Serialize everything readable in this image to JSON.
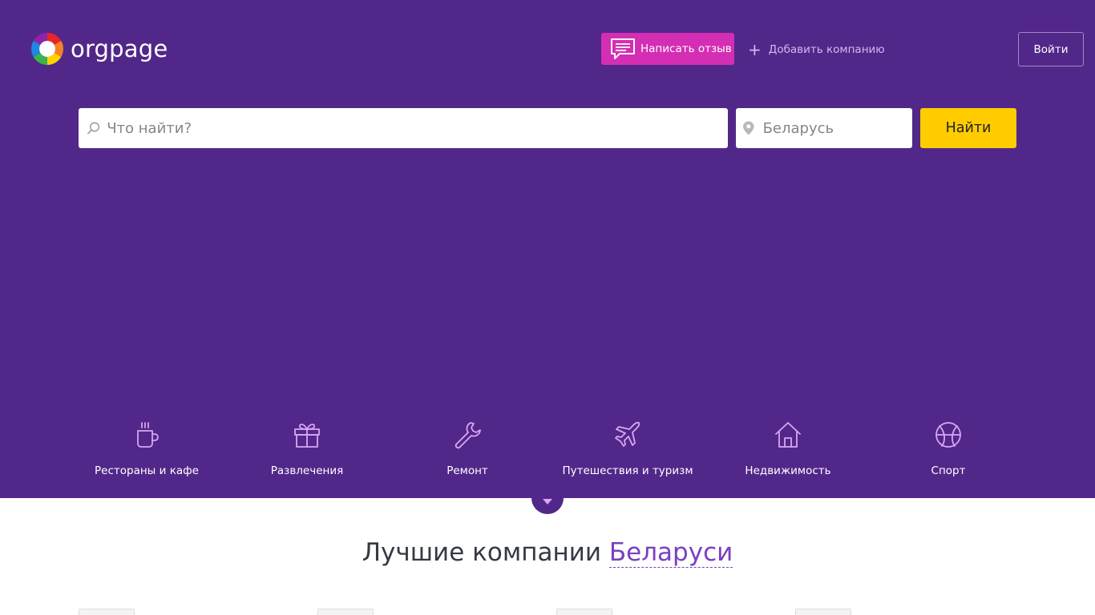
{
  "brand": {
    "name": "orgpage"
  },
  "header": {
    "write_review": "Написать отзыв",
    "add_company": "Добавить компанию",
    "login": "Войти"
  },
  "search": {
    "query_placeholder": "Что найти?",
    "location_placeholder": "Беларусь",
    "button": "Найти"
  },
  "categories": [
    {
      "label": "Рестораны и кафе",
      "icon": "coffee-cup-icon"
    },
    {
      "label": "Развлечения",
      "icon": "gift-icon"
    },
    {
      "label": "Ремонт",
      "icon": "wrench-icon"
    },
    {
      "label": "Путешествия и туризм",
      "icon": "airplane-icon"
    },
    {
      "label": "Недвижимость",
      "icon": "house-icon"
    },
    {
      "label": "Спорт",
      "icon": "basketball-icon"
    }
  ],
  "best": {
    "title": "Лучшие компании",
    "country": "Беларуси"
  },
  "colors": {
    "hero_bg": "#52278a",
    "review_btn": "#d42eb4",
    "find_btn": "#ffcc00",
    "accent": "#7a3fc2",
    "category_icon": "#d9a6f2"
  }
}
